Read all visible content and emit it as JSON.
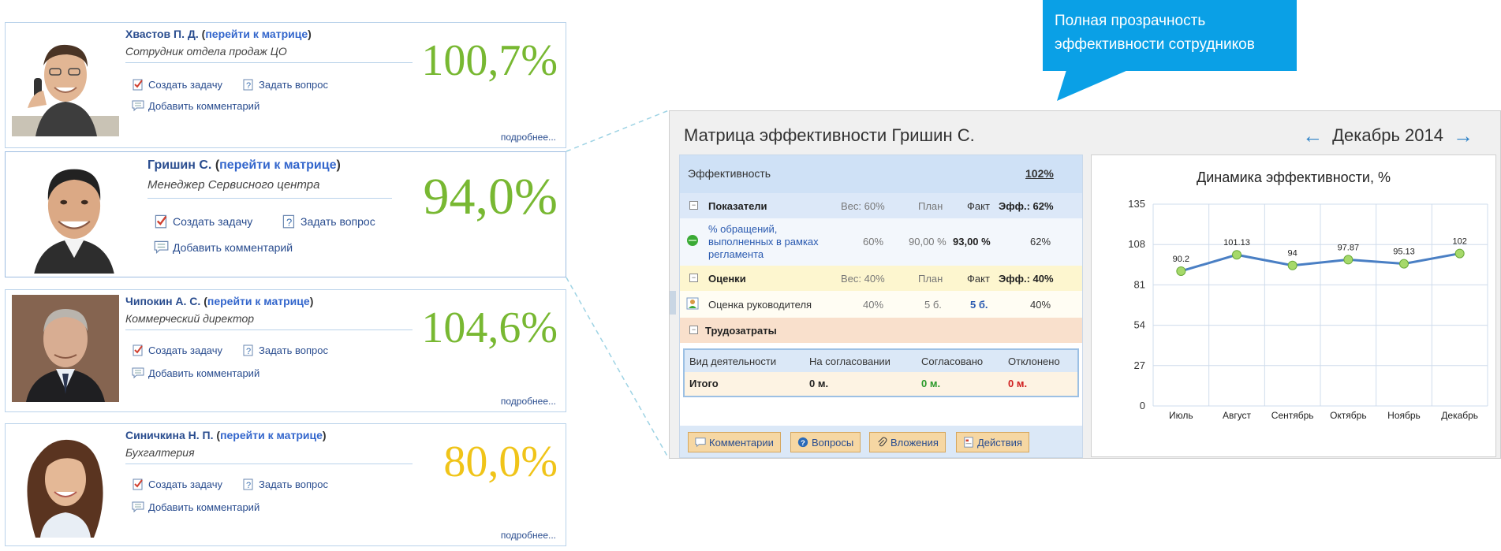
{
  "callout": {
    "line1": "Полная прозрачность",
    "line2": "эффективности сотрудников"
  },
  "common": {
    "matrix_link": "перейти к матрице",
    "create_task": "Создать задачу",
    "ask_question": "Задать вопрос",
    "add_comment": "Добавить комментарий",
    "more": "подробнее..."
  },
  "employees": [
    {
      "name": "Хвастов П. Д.",
      "role": "Сотрудник отдела продаж ЦО",
      "pct": "100,7%",
      "color": "#78b832"
    },
    {
      "name": "Гришин С.",
      "role": "Менеджер Сервисного центра",
      "pct": "94,0%",
      "color": "#78b832"
    },
    {
      "name": "Чипокин А. С.",
      "role": "Коммерческий директор",
      "pct": "104,6%",
      "color": "#78b832"
    },
    {
      "name": "Синичкина Н. П.",
      "role": "Бухгалтерия",
      "pct": "80,0%",
      "color": "#f0c419"
    }
  ],
  "matrix": {
    "title": "Матрица эффективности Гришин С.",
    "month": "Декабрь 2014",
    "efficiency_label": "Эффективность",
    "efficiency_value": "102%",
    "indicators": {
      "label": "Показатели",
      "weight": "Вес: 60%",
      "plan": "План",
      "fact": "Факт",
      "eff": "Эфф.: 62%"
    },
    "indicator_row": {
      "name": "% обращений, выполненных в рамках регламента",
      "weight": "60%",
      "plan": "90,00 %",
      "fact": "93,00 %",
      "eff": "62%"
    },
    "ratings": {
      "label": "Оценки",
      "weight": "Вес: 40%",
      "plan": "План",
      "fact": "Факт",
      "eff": "Эфф.: 40%"
    },
    "rating_row": {
      "name": "Оценка руководителя",
      "weight": "40%",
      "plan": "5 б.",
      "fact": "5 б.",
      "eff": "40%"
    },
    "labor": {
      "label": "Трудозатраты"
    },
    "labor_table": {
      "headers": [
        "Вид деятельности",
        "На согласовании",
        "Согласовано",
        "Отклонено"
      ],
      "total": {
        "label": "Итого",
        "pending": "0 м.",
        "approved": "0 м.",
        "rejected": "0 м."
      }
    },
    "buttons": {
      "comments": "Комментарии",
      "questions": "Вопросы",
      "attachments": "Вложения",
      "actions": "Действия"
    }
  },
  "chart_data": {
    "type": "line",
    "title": "Динамика эффективности, %",
    "categories": [
      "Июль",
      "Август",
      "Сентябрь",
      "Октябрь",
      "Ноябрь",
      "Декабрь"
    ],
    "values": [
      90.2,
      101.13,
      94,
      97.87,
      95.13,
      102
    ],
    "data_labels": [
      "90.2",
      "101.13",
      "94",
      "97.87",
      "95.13",
      "102"
    ],
    "yticks": [
      "0",
      "27",
      "54",
      "81",
      "108",
      "135"
    ],
    "ylim": [
      0,
      135
    ],
    "grid": true,
    "colors": {
      "line": "#4a7fc4",
      "marker": "#a6d96a"
    }
  }
}
